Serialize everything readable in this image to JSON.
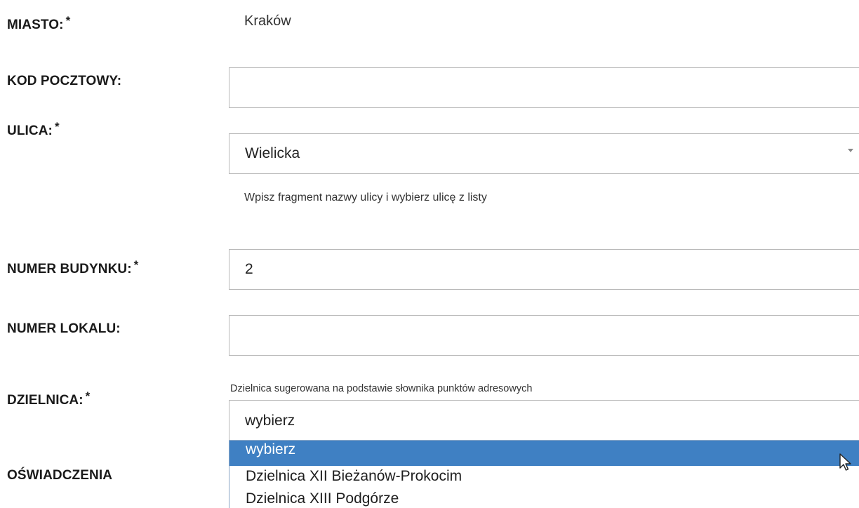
{
  "form": {
    "miasto": {
      "label": "MIASTO:",
      "required_mark": "*",
      "value": "Kraków"
    },
    "kod_pocztowy": {
      "label": "KOD POCZTOWY:",
      "value": ""
    },
    "ulica": {
      "label": "ULICA:",
      "required_mark": "*",
      "value": "Wielicka",
      "hint": "Wpisz fragment nazwy ulicy i wybierz ulicę z listy"
    },
    "numer_budynku": {
      "label": "NUMER BUDYNKU:",
      "required_mark": "*",
      "value": "2"
    },
    "numer_lokalu": {
      "label": "NUMER LOKALU:",
      "value": ""
    },
    "dzielnica": {
      "label": "DZIELNICA:",
      "required_mark": "*",
      "hint": "Dzielnica sugerowana na podstawie słownika punktów adresowych",
      "value": "wybierz",
      "options": [
        "wybierz",
        "Dzielnica XII Bieżanów-Prokocim",
        "Dzielnica XIII Podgórze"
      ],
      "highlighted_option_index": 0
    },
    "oswiadczenia": {
      "label": "OŚWIADCZENIA"
    }
  },
  "colors": {
    "highlight": "#3f80c3",
    "border": "#b9b9b9"
  }
}
